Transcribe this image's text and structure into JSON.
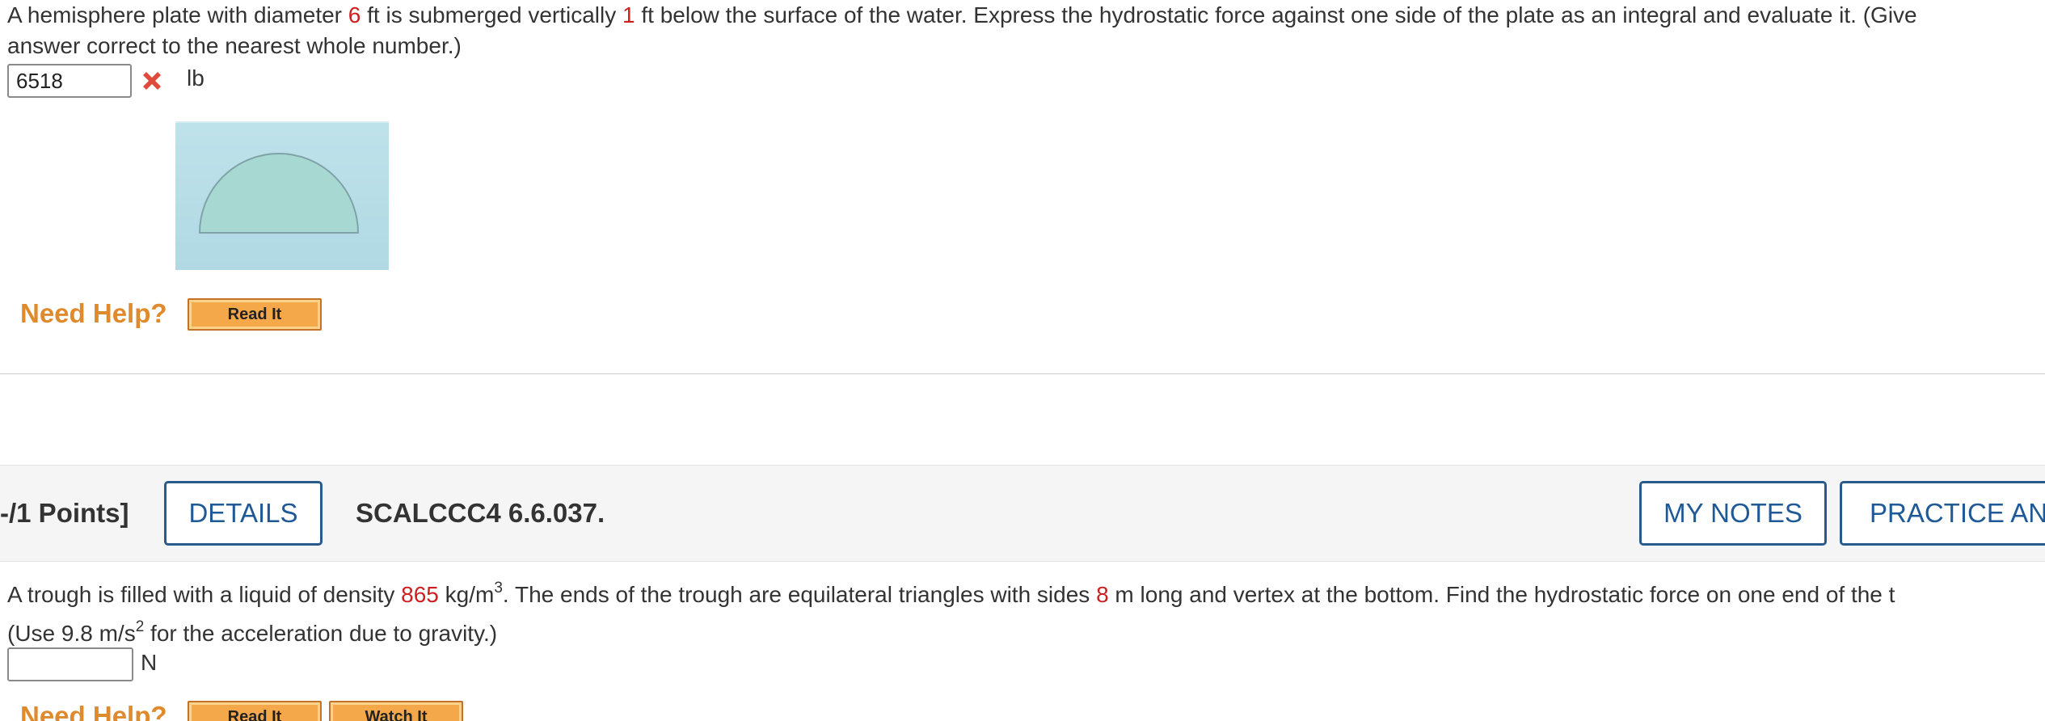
{
  "question1": {
    "text_part1": "A hemisphere plate with diameter ",
    "diameter": "6",
    "text_part2": " ft is submerged vertically ",
    "depth": "1",
    "text_part3": " ft below the surface of the water. Express the hydrostatic force against one side of the plate as an integral and evaluate it. (Give",
    "text_line2": "answer correct to the nearest whole number.)",
    "answer_value": "6518",
    "answer_status": "incorrect",
    "unit": "lb",
    "need_help_label": "Need Help?",
    "read_it_label": "Read It"
  },
  "question2": {
    "points_label": "-/1 Points]",
    "details_label": "DETAILS",
    "code": "SCALCCC4 6.6.037.",
    "my_notes_label": "MY NOTES",
    "practice_label": "PRACTICE ANOTHER",
    "text_part1": "A trough is filled with a liquid of density ",
    "density": "865",
    "text_part2": " kg/m",
    "density_exp": "3",
    "text_part3": ". The ends of the trough are equilateral triangles with sides ",
    "side": "8",
    "text_part4": " m long and vertex at the bottom. Find the hydrostatic force on one end of the t",
    "line2_part1": "(Use 9.8 m/s",
    "line2_exp": "2",
    "line2_part2": " for the acceleration due to gravity.)",
    "answer_value": "",
    "unit": "N",
    "need_help_label": "Need Help?",
    "read_it_label": "Read It",
    "watch_it_label": "Watch It"
  },
  "colors": {
    "highlight_number": "#cc1f1f",
    "need_help": "#e08a2e",
    "button_blue": "#1f5a96",
    "figure_water": "#b7dde6",
    "figure_plate": "#a8d8d2",
    "incorrect_mark": "#e04a3a"
  },
  "icons": {
    "incorrect": "x-mark-icon"
  }
}
